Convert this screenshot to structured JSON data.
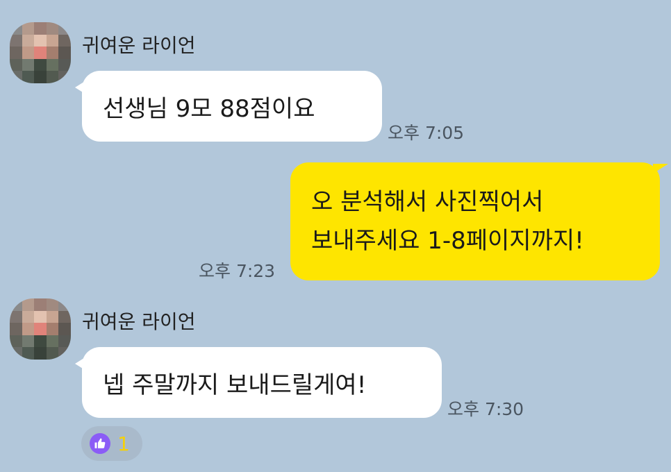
{
  "colors": {
    "background": "#b2c7da",
    "incoming_bubble": "#ffffff",
    "outgoing_bubble": "#fee500",
    "reaction_icon": "#8b5cf6",
    "reaction_count": "#f5d10a"
  },
  "messages": [
    {
      "direction": "incoming",
      "sender": "귀여운 라이언",
      "avatar_icon": "pixelated-profile-avatar",
      "text": "선생님 9모 88점이요",
      "time": "오후 7:05"
    },
    {
      "direction": "outgoing",
      "lines": [
        "오 분석해서 사진찍어서",
        "보내주세요 1-8페이지까지!"
      ],
      "time": "오후 7:23"
    },
    {
      "direction": "incoming",
      "sender": "귀여운 라이언",
      "avatar_icon": "pixelated-profile-avatar",
      "text": "넵 주말까지 보내드릴게여!",
      "time": "오후 7:30",
      "reaction": {
        "icon": "thumbs-up-icon",
        "count": "1"
      }
    }
  ]
}
